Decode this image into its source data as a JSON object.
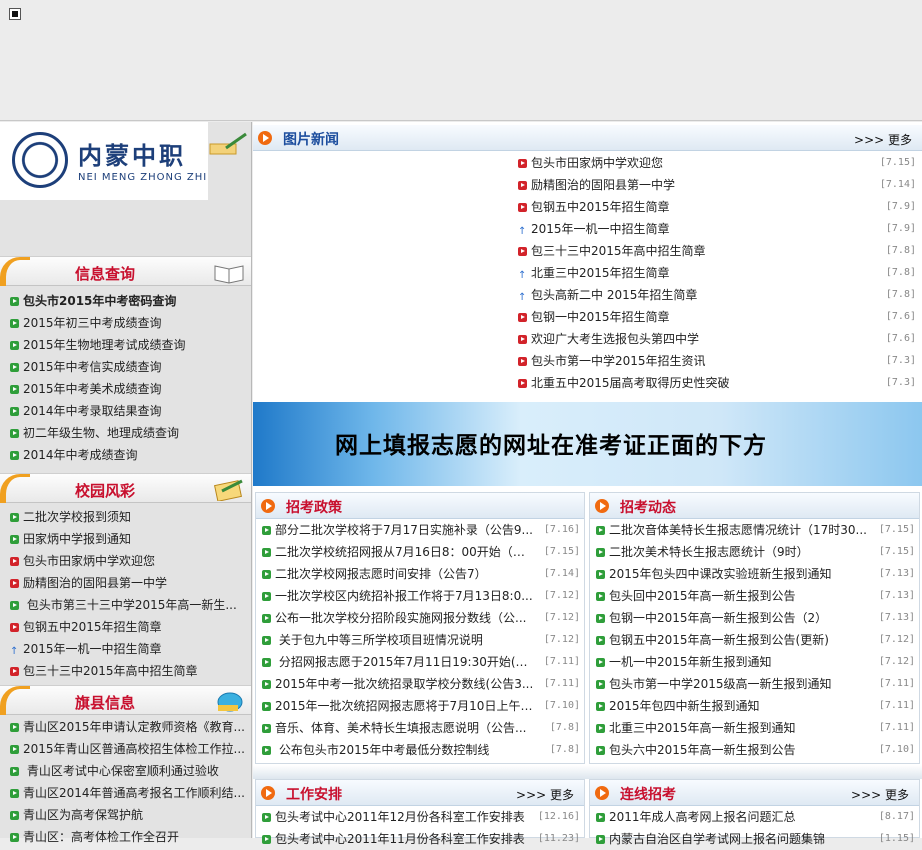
{
  "logo": {
    "cn": "内蒙中职",
    "en": "NEI MENG ZHONG ZHI"
  },
  "left": {
    "info": {
      "title": "信息查询",
      "items": [
        {
          "text": "包头市2015年中考密码查询",
          "bold": true
        },
        {
          "text": "2015年初三中考成绩查询"
        },
        {
          "text": "2015年生物地理考试成绩查询"
        },
        {
          "text": "2015年中考信实成绩查询"
        },
        {
          "text": "2015年中考美术成绩查询"
        },
        {
          "text": "2014年中考录取结果查询"
        },
        {
          "text": "初二年级生物、地理成绩查询"
        },
        {
          "text": "2014年中考成绩查询"
        }
      ]
    },
    "campus": {
      "title": "校园风彩",
      "items": [
        {
          "text": "二批次学校报到须知",
          "b": "g"
        },
        {
          "text": "田家炳中学报到通知",
          "b": "g"
        },
        {
          "text": "包头市田家炳中学欢迎您",
          "b": "r"
        },
        {
          "text": "励精图治的固阳县第一中学",
          "b": "r"
        },
        {
          "text": " 包头市第三十三中学2015年高一新生...",
          "b": "g"
        },
        {
          "text": "包钢五中2015年招生简章",
          "b": "r"
        },
        {
          "text": "2015年一机一中招生简章",
          "b": "u"
        },
        {
          "text": "包三十三中2015年高中招生简章",
          "b": "r"
        }
      ]
    },
    "county": {
      "title": "旗县信息",
      "items": [
        {
          "text": "青山区2015年申请认定教师资格《教育..."
        },
        {
          "text": "2015年青山区普通高校招生体检工作拉..."
        },
        {
          "text": " 青山区考试中心保密室顺利通过验收"
        },
        {
          "text": "青山区2014年普通高考报名工作顺利结..."
        },
        {
          "text": "青山区为高考保驾护航"
        },
        {
          "text": "青山区：高考体检工作全召开"
        }
      ]
    }
  },
  "news": {
    "title": "图片新闻",
    "more": ">>> 更多",
    "items": [
      {
        "text": "包头市田家炳中学欢迎您",
        "date": "[7.15]",
        "b": "r"
      },
      {
        "text": "励精图治的固阳县第一中学",
        "date": "[7.14]",
        "b": "r"
      },
      {
        "text": "包钢五中2015年招生简章",
        "date": "[7.9]",
        "b": "r"
      },
      {
        "text": "2015年一机一中招生简章",
        "date": "[7.9]",
        "b": "u"
      },
      {
        "text": "包三十三中2015年高中招生简章",
        "date": "[7.8]",
        "b": "r"
      },
      {
        "text": "北重三中2015年招生简章",
        "date": "[7.8]",
        "b": "u"
      },
      {
        "text": "包头高新二中 2015年招生简章",
        "date": "[7.8]",
        "b": "u"
      },
      {
        "text": "包钢一中2015年招生简章",
        "date": "[7.6]",
        "b": "r"
      },
      {
        "text": "欢迎广大考生选报包头第四中学",
        "date": "[7.6]",
        "b": "r"
      },
      {
        "text": "包头市第一中学2015年招生资讯",
        "date": "[7.3]",
        "b": "r"
      },
      {
        "text": "北重五中2015届高考取得历史性突破",
        "date": "[7.3]",
        "b": "r"
      }
    ]
  },
  "banner": {
    "text": "网上填报志愿的网址在准考证正面的下方"
  },
  "policy": {
    "title": "招考政策",
    "items": [
      {
        "text": "部分二批次学校将于7月17日实施补录（公告9...",
        "date": "[7.16]"
      },
      {
        "text": "二批次学校统招网报从7月16日8：00开始（公...",
        "date": "[7.15]"
      },
      {
        "text": "二批次学校网报志愿时间安排（公告7）",
        "date": "[7.14]"
      },
      {
        "text": "一批次学校区内统招补报工作将于7月13日8:0...",
        "date": "[7.12]"
      },
      {
        "text": "公布一批次学校分招阶段实施网报分数线（公...",
        "date": "[7.12]"
      },
      {
        "text": " 关于包九中等三所学校项目班情况说明",
        "date": "[7.12]"
      },
      {
        "text": " 分招网报志愿于2015年7月11日19:30开始(公告...",
        "date": "[7.11]"
      },
      {
        "text": "2015年中考一批次统招录取学校分数线(公告3...",
        "date": "[7.11]"
      },
      {
        "text": "2015年一批次统招网报志愿将于7月10日上午8...",
        "date": "[7.10]"
      },
      {
        "text": "音乐、体育、美术特长生填报志愿说明（公告...",
        "date": "[7.8]"
      },
      {
        "text": " 公布包头市2015年中考最低分数控制线",
        "date": "[7.8]"
      }
    ]
  },
  "dynamics": {
    "title": "招考动态",
    "items": [
      {
        "text": "二批次音体美特长生报志愿情况统计（17时30...",
        "date": "[7.15]"
      },
      {
        "text": "二批次美术特长生报志愿统计（9时）",
        "date": "[7.15]"
      },
      {
        "text": "2015年包头四中课改实验班新生报到通知",
        "date": "[7.13]"
      },
      {
        "text": "包头回中2015年高一新生报到公告",
        "date": "[7.13]"
      },
      {
        "text": "包钢一中2015年高一新生报到公告（2）",
        "date": "[7.13]"
      },
      {
        "text": "包钢五中2015年高一新生报到公告(更新)",
        "date": "[7.12]"
      },
      {
        "text": "一机一中2015年新生报到通知",
        "date": "[7.12]"
      },
      {
        "text": "包头市第一中学2015级高一新生报到通知",
        "date": "[7.11]"
      },
      {
        "text": "2015年包四中新生报到通知",
        "date": "[7.11]"
      },
      {
        "text": "北重三中2015年高一新生报到通知",
        "date": "[7.11]"
      },
      {
        "text": "包头六中2015年高一新生报到公告",
        "date": "[7.10]"
      }
    ]
  },
  "work": {
    "title": "工作安排",
    "more": ">>> 更多",
    "items": [
      {
        "text": "包头考试中心2011年12月份各科室工作安排表",
        "date": "[12.16]"
      },
      {
        "text": "包头考试中心2011年11月份各科室工作安排表",
        "date": "[11.23]"
      }
    ]
  },
  "online": {
    "title": "连线招考",
    "more": ">>> 更多",
    "items": [
      {
        "text": "2011年成人高考网上报名问题汇总",
        "date": "[8.17]"
      },
      {
        "text": "内蒙古自治区自学考试网上报名问题集锦",
        "date": "[1.15]"
      }
    ]
  },
  "colors": {
    "accent_red": "#c8102e",
    "accent_blue": "#1d4e9e",
    "bullet_green": "#2f9e3a",
    "bullet_red": "#d2232a"
  }
}
